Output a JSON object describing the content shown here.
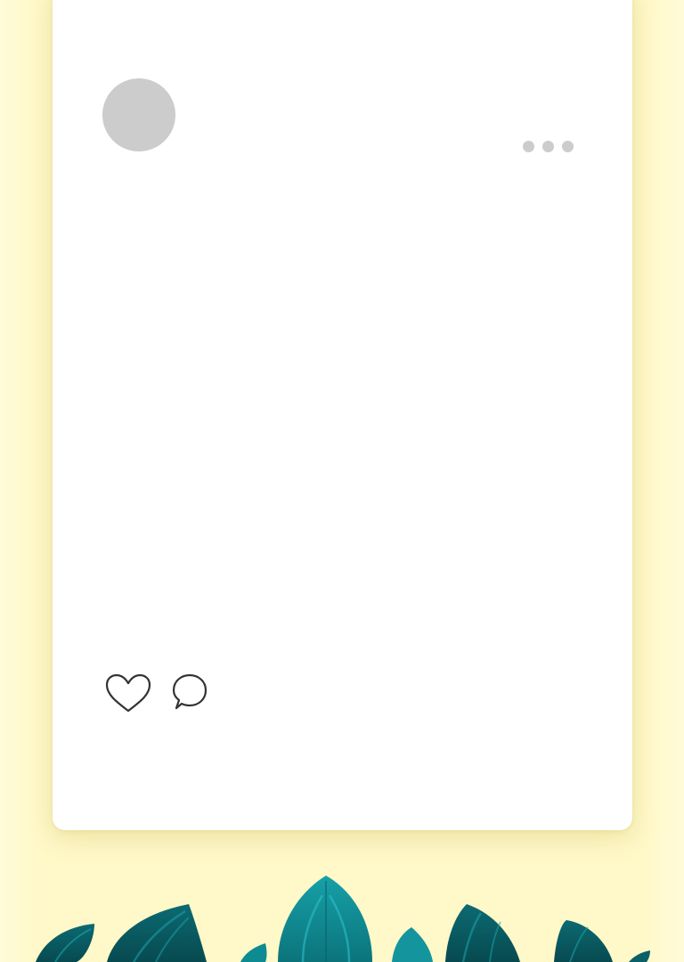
{
  "post": {
    "avatar": {
      "icon": "avatar-placeholder",
      "color": "#cccccc"
    },
    "more_menu": {
      "icon": "ellipsis-icon",
      "dot_color": "#cccccc"
    },
    "actions": [
      {
        "icon": "heart-icon"
      },
      {
        "icon": "comment-icon"
      }
    ]
  },
  "theme": {
    "background": "#fff8c8",
    "card": "#ffffff",
    "leaf_dark": "#0b5960",
    "leaf_mid": "#0f7f86",
    "leaf_light": "#1aa3ab"
  },
  "decoration": {
    "name": "tropical-leaves"
  }
}
